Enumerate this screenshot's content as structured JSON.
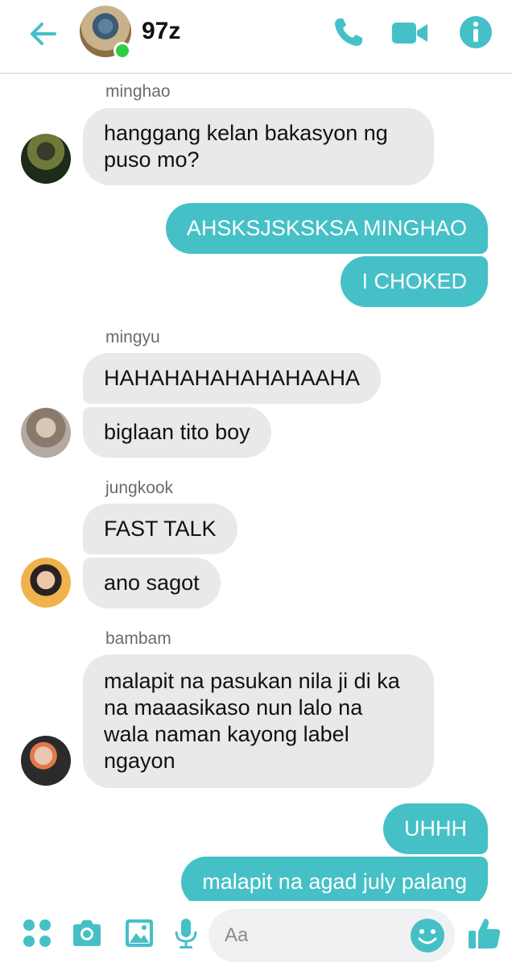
{
  "header": {
    "title": "97z",
    "online": true,
    "icons": [
      "back-arrow-icon",
      "phone-icon",
      "video-camera-icon",
      "info-icon"
    ]
  },
  "colors": {
    "accent": "#45c0c7",
    "incoming_bubble": "#e9e9eb",
    "online": "#31cc46"
  },
  "messages": {
    "m1": {
      "sender": "minghao",
      "text": "hanggang kelan bakasyon ng puso mo?"
    },
    "m2": {
      "text": "AHSKSJSKSKSA MINGHAO"
    },
    "m3": {
      "text": "I CHOKED"
    },
    "m4": {
      "sender": "mingyu",
      "text": "HAHAHAHAHAHAHAAHA"
    },
    "m5": {
      "text": "biglaan tito boy"
    },
    "m6": {
      "sender": "jungkook",
      "text": "FAST TALK"
    },
    "m7": {
      "text": "ano sagot"
    },
    "m8": {
      "sender": "bambam",
      "text": "malapit na pasukan nila ji di ka na maaasikaso nun lalo na wala naman kayong label ngayon"
    },
    "m9": {
      "text": "UHHH"
    },
    "m10": {
      "text": "malapit na agad july palang"
    }
  },
  "composer": {
    "placeholder": "Aa",
    "icons": [
      "apps-grid-icon",
      "camera-icon",
      "image-icon",
      "microphone-icon",
      "emoji-icon",
      "thumbs-up-icon"
    ]
  }
}
